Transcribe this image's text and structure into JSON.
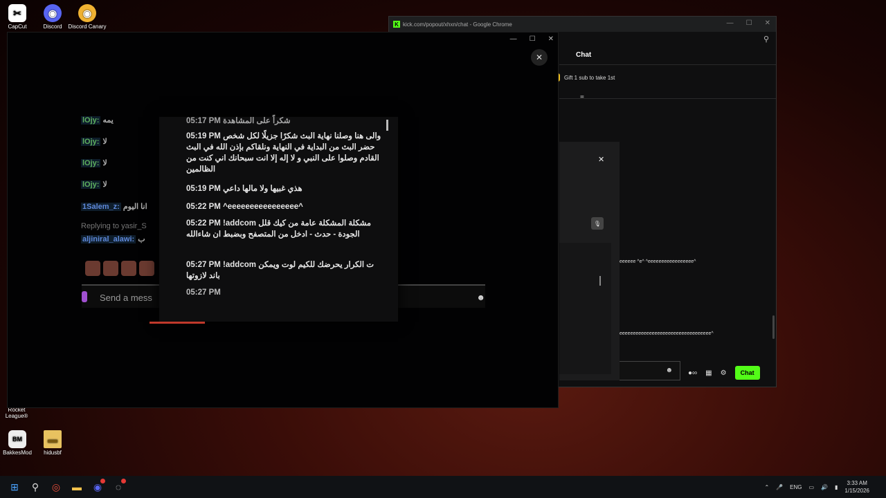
{
  "desktop": {
    "icons_top": [
      {
        "label": "CapCut",
        "glyph": "✂",
        "color": "#ffffff"
      },
      {
        "label": "Discord",
        "glyph": "◉",
        "color": "#5865f2"
      },
      {
        "label": "Discord Canary",
        "glyph": "◉",
        "color": "#f0b232"
      }
    ],
    "icons_bottom": [
      {
        "label": "Rocket League®"
      },
      {
        "label": "BakkesMod",
        "glyph": "BM"
      },
      {
        "label": "hidusbf",
        "glyph": "▬"
      }
    ]
  },
  "chrome": {
    "title": "kick.com/popout/xhxn/chat - Google Chrome",
    "chat_tab": "Chat",
    "gift_text": "Gift 1 sub to take 1st",
    "chat_lines": [
      "eeeeee ^e^ ^eeeeeeeeeeeeeeeee^",
      "eeeeeeeeeeeeeeeeeeeeeeeeeeeeeeeeee^"
    ],
    "send_label": "Chat",
    "accent": "#53fc18"
  },
  "discord": {
    "input_placeholder": "Send a mess",
    "replying": "Replying to yasir_S",
    "messages": [
      {
        "user": "lOjy:",
        "text": "يمه"
      },
      {
        "user": "lOjy:",
        "text": "لا"
      },
      {
        "user": "lOjy:",
        "text": "لا"
      },
      {
        "user": "lOjy:",
        "text": "لا"
      },
      {
        "user": "1Salem_z:",
        "text": "انا اليوم"
      },
      {
        "user": "aljiniral_alawi:",
        "text": "ب"
      }
    ]
  },
  "zoomed": {
    "entries": [
      {
        "time": "05:17 PM",
        "text": "شكراً على المشاهدة"
      },
      {
        "time": "05:19 PM",
        "text": "والى هنا وصلنا نهاية البث شكرًا جزيلًا لكل شخص حضر البث من البداية في النهاية ونلقاكم بإذن الله في البث القادم وصلوا على النبي و لا إله إلا انت سبحانك اني كنت من الظالمين"
      },
      {
        "time": "05:19 PM",
        "text": "هذي غبيها ولا مالها داعي"
      },
      {
        "time": "05:22 PM",
        "text": "^eeeeeeeeeeeeeeee^"
      },
      {
        "time": "05:22 PM !addcom",
        "text": "مشكلة المشكلة عامة من كيك قلل الجودة - حدث - ادخل من المتصفح وبضبط ان شاءالله"
      },
      {
        "time": "05:27 PM !addcom",
        "text": "ت الكرار يحرضك للكيم لوت ويمكن باند لازوتها"
      },
      {
        "time": "05:27 PM",
        "text": ""
      }
    ]
  },
  "taskbar": {
    "lang": "ENG",
    "time": "3:33 AM",
    "date": "1/15/2026"
  }
}
